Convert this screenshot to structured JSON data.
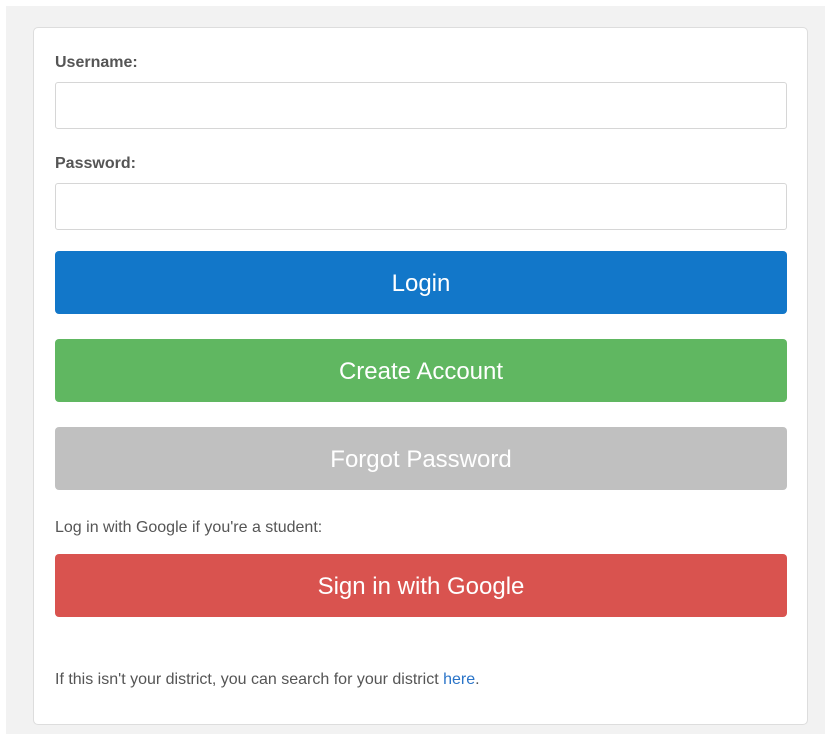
{
  "login_form": {
    "username_label": "Username:",
    "username_value": "",
    "password_label": "Password:",
    "password_value": "",
    "login_label": "Login",
    "create_account_label": "Create Account",
    "forgot_password_label": "Forgot Password",
    "google_prompt": "Log in with Google if you're a student:",
    "google_signin_label": "Sign in with Google",
    "district_text": "If this isn't your district, you can search for your district ",
    "district_link": "here",
    "district_period": "."
  },
  "colors": {
    "login": "#1277c9",
    "create_account": "#60b761",
    "forgot_password": "#c0c0c0",
    "google_signin": "#d9534f",
    "link": "#2a74c8"
  }
}
